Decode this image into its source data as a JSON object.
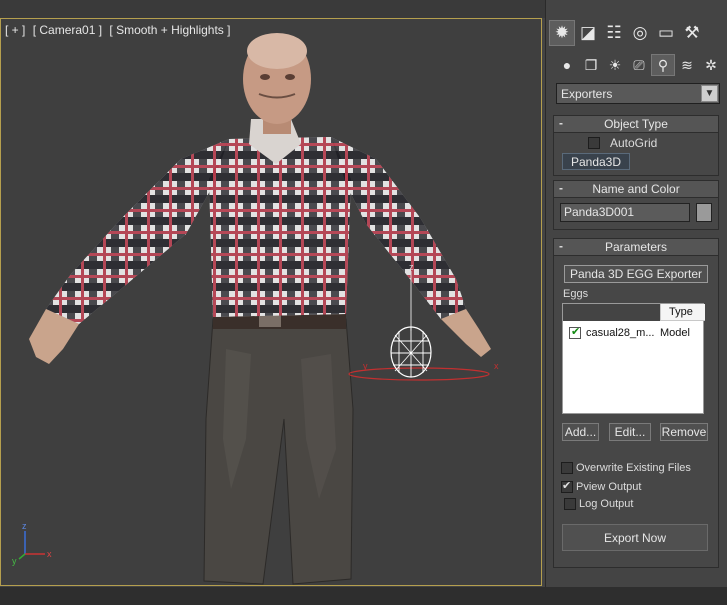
{
  "viewport": {
    "label_parts": [
      "[ + ]",
      "[ Camera01 ]",
      "[ Smooth + Highlights ]"
    ],
    "gizmo_axis_labels": {
      "x": "x",
      "y": "y",
      "z": "z"
    },
    "axis_tripod": {
      "x": "x",
      "y": "y",
      "z": "z"
    },
    "colors": {
      "frame": "#b59f4e",
      "background": "#3f3f3f",
      "helper_circle": "#c23030"
    }
  },
  "command_panel": {
    "main_tabs": [
      {
        "icon": "create-icon",
        "glyph": "✹",
        "active": true
      },
      {
        "icon": "modify-icon",
        "glyph": "◪",
        "active": false
      },
      {
        "icon": "hierarchy-icon",
        "glyph": "☷",
        "active": false
      },
      {
        "icon": "motion-icon",
        "glyph": "◎",
        "active": false
      },
      {
        "icon": "display-icon",
        "glyph": "▭",
        "active": false
      },
      {
        "icon": "utilities-icon",
        "glyph": "⚒",
        "active": false
      }
    ],
    "sub_tabs": [
      {
        "icon": "geometry-icon",
        "glyph": "●",
        "active": false
      },
      {
        "icon": "shapes-icon",
        "glyph": "❐",
        "active": false
      },
      {
        "icon": "lights-icon",
        "glyph": "☀",
        "active": false
      },
      {
        "icon": "cameras-icon",
        "glyph": "⎚",
        "active": false
      },
      {
        "icon": "helpers-icon",
        "glyph": "⚲",
        "active": true
      },
      {
        "icon": "space-warps-icon",
        "glyph": "≋",
        "active": false
      },
      {
        "icon": "systems-icon",
        "glyph": "✲",
        "active": false
      }
    ],
    "category_dropdown": {
      "value": "Exporters"
    },
    "object_type": {
      "title": "Object Type",
      "autogrid_label": "AutoGrid",
      "autogrid_checked": false,
      "button": "Panda3D"
    },
    "name_and_color": {
      "title": "Name and Color",
      "name_value": "Panda3D001",
      "color": "#9a9a9a"
    },
    "parameters": {
      "title": "Parameters",
      "exporter_button": "Panda 3D EGG Exporter",
      "eggs_label": "Eggs",
      "list_header_type": "Type",
      "list_rows": [
        {
          "name": "casual28_m...",
          "type": "Model",
          "checked": true
        }
      ],
      "add_button": "Add...",
      "edit_button": "Edit...",
      "remove_button": "Remove",
      "overwrite_label": "Overwrite Existing Files",
      "overwrite_checked": false,
      "pview_label": "Pview Output",
      "pview_checked": true,
      "log_label": "Log Output",
      "log_checked": false,
      "export_button": "Export Now"
    }
  }
}
